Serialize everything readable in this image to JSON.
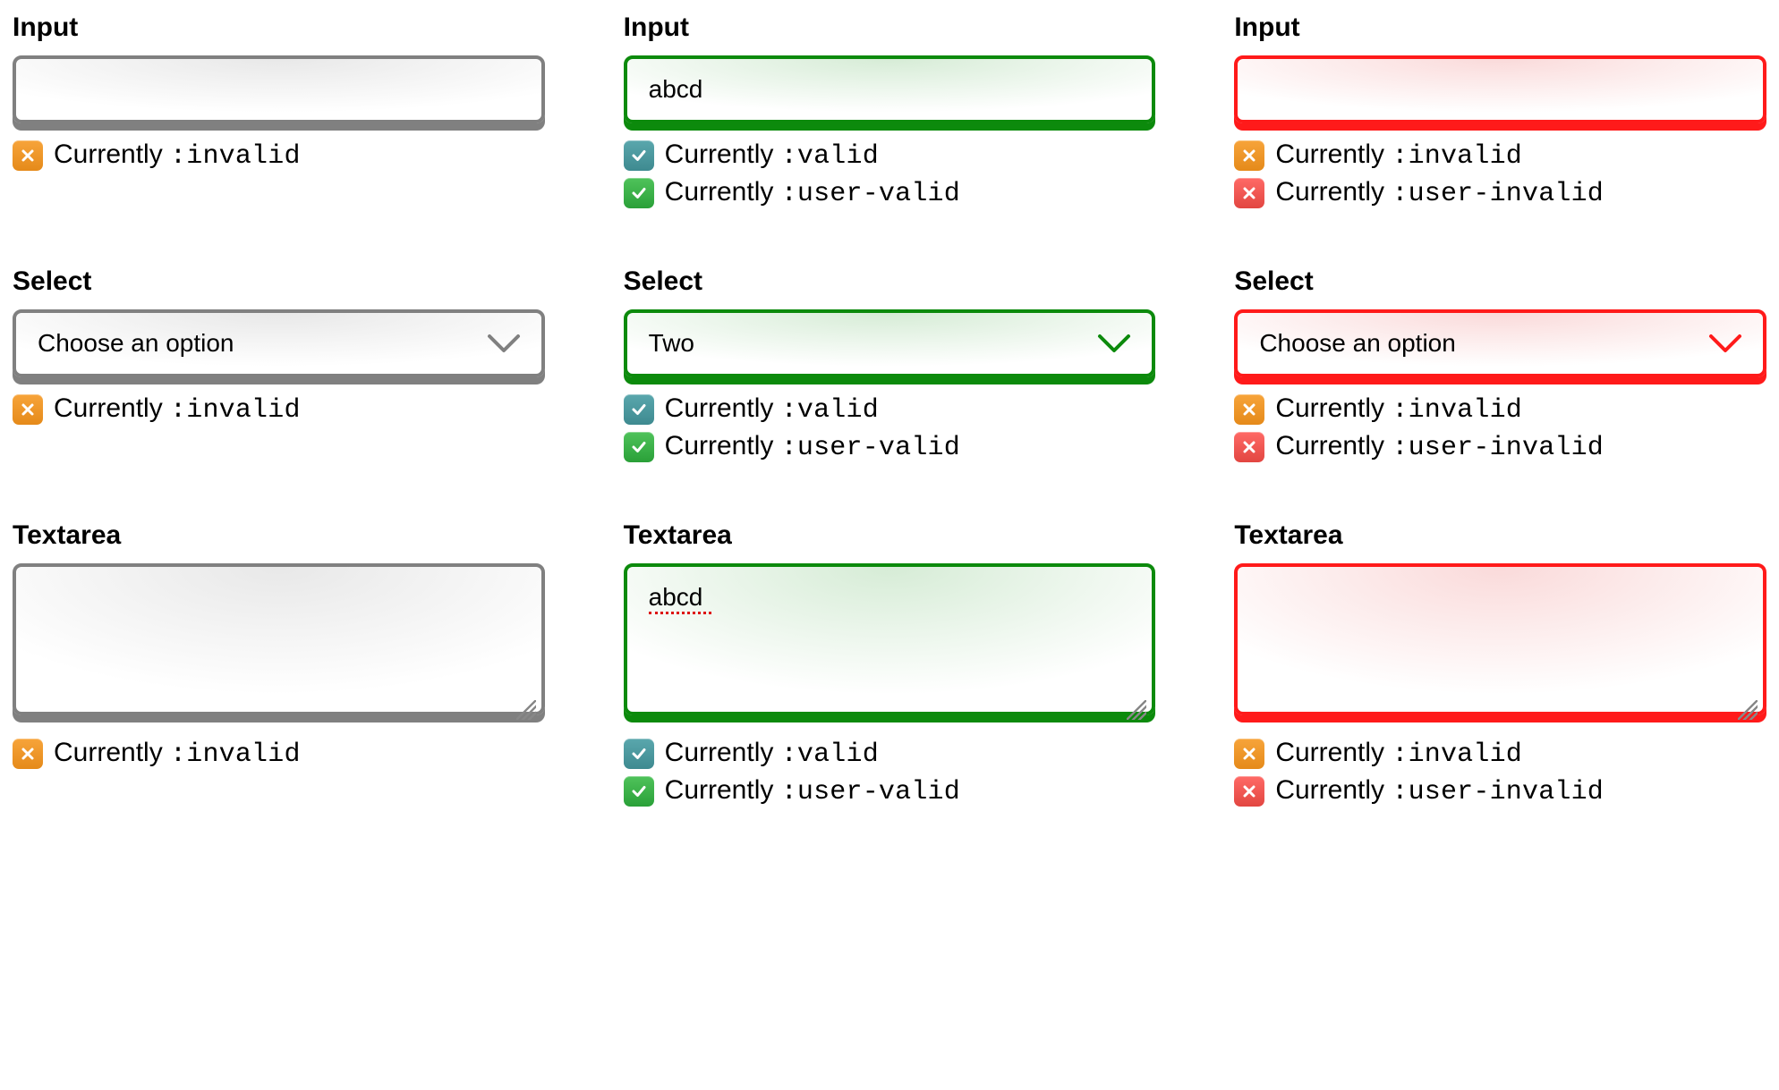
{
  "status_prefix": "Currently ",
  "columns": [
    {
      "state": "grey",
      "input": {
        "label": "Input",
        "value": ""
      },
      "select": {
        "label": "Select",
        "value": "Choose an option"
      },
      "textarea": {
        "label": "Textarea",
        "value": ""
      },
      "statuses": [
        {
          "icon": "x-orange",
          "code": ":invalid"
        }
      ]
    },
    {
      "state": "green",
      "input": {
        "label": "Input",
        "value": "abcd"
      },
      "select": {
        "label": "Select",
        "value": "Two"
      },
      "textarea": {
        "label": "Textarea",
        "value": "abcd"
      },
      "statuses": [
        {
          "icon": "check-teal",
          "code": ":valid"
        },
        {
          "icon": "check-green",
          "code": ":user-valid"
        }
      ]
    },
    {
      "state": "red",
      "input": {
        "label": "Input",
        "value": ""
      },
      "select": {
        "label": "Select",
        "value": "Choose an option"
      },
      "textarea": {
        "label": "Textarea",
        "value": ""
      },
      "statuses": [
        {
          "icon": "x-orange",
          "code": ":invalid"
        },
        {
          "icon": "x-red",
          "code": ":user-invalid"
        }
      ]
    }
  ],
  "icons": {
    "x-orange": {
      "box": "box-orange",
      "glyph": "x"
    },
    "check-teal": {
      "box": "box-teal",
      "glyph": "check"
    },
    "check-green": {
      "box": "box-green",
      "glyph": "check"
    },
    "x-red": {
      "box": "box-red",
      "glyph": "x"
    }
  }
}
